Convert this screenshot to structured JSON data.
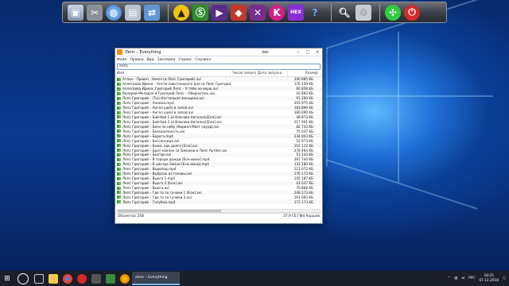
{
  "window": {
    "title": "Лепс – Everything",
    "title_part2": "лес",
    "menu": [
      "Файл",
      "Правка",
      "Вид",
      "Закладки",
      "Сервис",
      "Справка"
    ],
    "search_value": "лепс",
    "columns": [
      "Имя",
      "Число запусков",
      "Дата запуска",
      "Размер"
    ],
    "status_left": "Объектов: 258",
    "status_right": "27,9 ГБ   ГФ4 Каршев"
  },
  "rows": [
    {
      "name": "Атлан - Привет, Земля (и Лепс Григорий).avi",
      "size": "240 885 KБ"
    },
    {
      "name": "Аллегрова Ирина – Англо-повстанцкого дня (и Лепс Григорий).avi",
      "size": "176 159 KБ"
    },
    {
      "name": "Аллегрова Ирина, Григорий Лепс – Я тебе не верю.avi",
      "size": "60 858 KБ"
    },
    {
      "name": "Валерий Меладзе и Григорий Лепс – Обернитесь.avi",
      "size": "16 892 KБ"
    },
    {
      "name": "Лепс Григорий – (Ты) Настоящая женщина.avi",
      "size": "91 260 KБ"
    },
    {
      "name": "Лепс Григорий – Аннина.mp4",
      "size": "205 975 KБ"
    },
    {
      "name": "Лепс Григорий – Ангел ушёл в запой.avi",
      "size": "183 899 KБ"
    },
    {
      "name": "Лепс Григорий – Ангел ушёл в запой.avi",
      "size": "180 090 KБ"
    },
    {
      "name": "Лепс Григорий – Бай-бай 1 (и Власова Наталья)[Есм].avi",
      "size": "49 873 KБ"
    },
    {
      "name": "Лепс Григорий – Бай-бай 2 (и Власова Наталья)[Есм].avi",
      "size": "217 901 KБ"
    },
    {
      "name": "Лепс Григорий – Беги по небу (Кирилл Маэт саунд).avi",
      "size": "82 733 KБ"
    },
    {
      "name": "Лепс Григорий – Бесконечность.avi",
      "size": "75 037 KБ"
    },
    {
      "name": "Лепс Григорий – Берега.mp4",
      "size": "234 803 KБ"
    },
    {
      "name": "Лепс Григорий – Бессонница.avi",
      "size": "52 973 KБ"
    },
    {
      "name": "Лепс Григорий – Боже, как долго [Есм].avi",
      "size": "103 112 KБ"
    },
    {
      "name": "Лепс Григорий – Брат-наклон (и Зимаков и Лепс Артём).avi",
      "size": "278 464 KБ"
    },
    {
      "name": "Лепс Григорий – Быстро.avi",
      "size": "53 143 KБ"
    },
    {
      "name": "Лепс Григорий – В городе дожди [Есм мини].mp4",
      "size": "287 744 KБ"
    },
    {
      "name": "Лепс Григорий – В центре Земли [Есм мини].mp4",
      "size": "131 180 KБ"
    },
    {
      "name": "Лепс Григорий – Водопад.mp4",
      "size": "121 072 KБ"
    },
    {
      "name": "Лепс Григорий – Выбрось из головы.avi",
      "size": "179 173 KБ"
    },
    {
      "name": "Лепс Григорий – Вьюга 1.mp4",
      "size": "145 187 KБ"
    },
    {
      "name": "Лепс Григорий – Вьюга 2 [Есм].avi",
      "size": "43 037 KБ"
    },
    {
      "name": "Лепс Григорий – Вьюга.avi",
      "size": "70 868 KБ"
    },
    {
      "name": "Лепс Григорий – Где то за тучами 1 [Есм].avi",
      "size": "248 273 KБ"
    },
    {
      "name": "Лепс Григорий – Где то за тучами 2.avi",
      "size": "191 093 KБ"
    },
    {
      "name": "Лепс Григорий – Голубей.mp4",
      "size": "173 173 KБ"
    }
  ],
  "taskbar": {
    "active_app": "лепс – Everything",
    "language": "РУС",
    "time": "18:25",
    "date": "07.12.2018"
  },
  "colors": {
    "dock_bg": "#3a3e46",
    "taskbar_bg": "#1a1f2a",
    "accent": "#76b9ed"
  },
  "dock_icons": [
    "computer-icon",
    "tools-icon",
    "globe-icon",
    "folder-icon",
    "transfer-icon",
    "a-logo-icon",
    "s-logo-icon",
    "play-icon",
    "diamond-icon",
    "k-icon",
    "hex-icon",
    "help-icon",
    "magnifier-icon",
    "recycle-bin-icon",
    "puzzle-icon",
    "power-icon"
  ]
}
